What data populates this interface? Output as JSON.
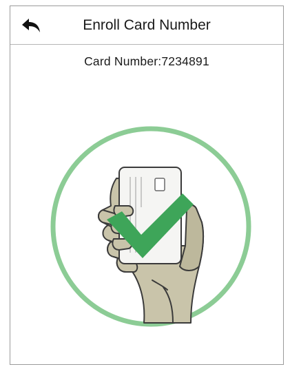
{
  "header": {
    "title": "Enroll Card Number",
    "back_icon": "back-arrow-icon"
  },
  "main": {
    "card_number_label": "Card Number:7234891",
    "status_icon": "checkmark-icon"
  },
  "colors": {
    "ring": "#8ccc95",
    "check": "#3ea559",
    "hand": "#c9c4aa",
    "card": "#f5f5f3"
  }
}
